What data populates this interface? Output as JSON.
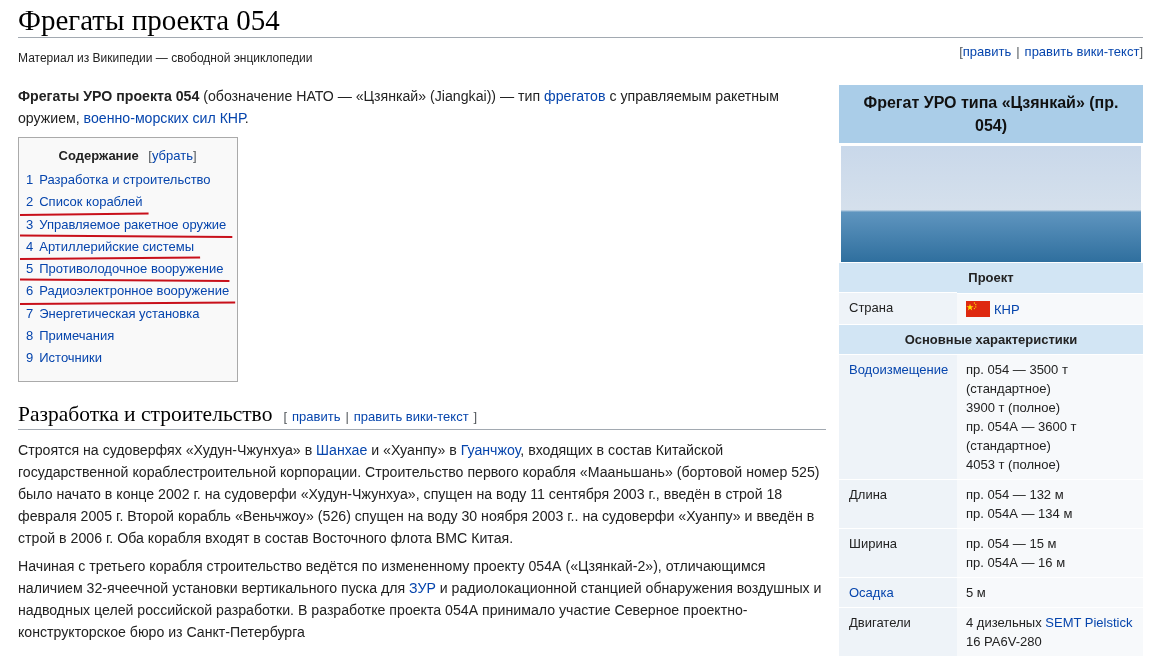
{
  "page": {
    "title": "Фрегаты проекта 054",
    "tagline": "Материал из Википедии — свободной энциклопедии",
    "edit_links": {
      "brackets": [
        "[",
        "]"
      ],
      "separator": "|",
      "links": [
        "править",
        "править вики-текст"
      ]
    }
  },
  "intro": [
    {
      "text": "Фрегаты УРО проекта 054",
      "kind": "bold"
    },
    {
      "text": " (обозначение НАТО — «Цзянкай» (Jiangkai)) — тип ",
      "kind": "text"
    },
    {
      "text": "фрегатов",
      "kind": "link"
    },
    {
      "text": " с управляемым ракетным оружием, ",
      "kind": "text"
    },
    {
      "text": "военно-морских сил КНР",
      "kind": "link"
    },
    {
      "text": ".",
      "kind": "text"
    }
  ],
  "toc": {
    "title": "Содержание",
    "toggle": {
      "brackets": [
        "[",
        "]"
      ],
      "label": "убрать"
    },
    "items": [
      {
        "number": "1",
        "label": "Разработка и строительство",
        "marked": false
      },
      {
        "number": "2",
        "label": "Список кораблей",
        "marked": true
      },
      {
        "number": "3",
        "label": "Управляемое ракетное оружие",
        "marked": true
      },
      {
        "number": "4",
        "label": "Артиллерийские системы",
        "marked": true
      },
      {
        "number": "5",
        "label": "Противолодочное вооружение",
        "marked": true
      },
      {
        "number": "6",
        "label": "Радиоэлектронное вооружение",
        "marked": true
      },
      {
        "number": "7",
        "label": "Энергетическая установка",
        "marked": false
      },
      {
        "number": "8",
        "label": "Примечания",
        "marked": false
      },
      {
        "number": "9",
        "label": "Источники",
        "marked": false
      }
    ]
  },
  "sections": [
    {
      "heading": "Разработка и строительство",
      "edit_links": {
        "brackets": [
          "[",
          "]"
        ],
        "separator": "|",
        "links": [
          "править",
          "править вики-текст"
        ]
      },
      "paragraphs": [
        [
          {
            "text": "Строятся на судоверфях «Худун-Чжунхуа» в ",
            "kind": "text"
          },
          {
            "text": "Шанхае",
            "kind": "link"
          },
          {
            "text": " и «Хуанпу» в ",
            "kind": "text"
          },
          {
            "text": "Гуанчжоу",
            "kind": "link"
          },
          {
            "text": ", входящих в состав Китайской государственной кораблестроительной корпорации. Строительство первого корабля «Мааньшань» (бортовой номер 525) было начато в конце 2002 г. на судоверфи «Худун-Чжунхуа», спущен на воду 11 сентября 2003 г., введён в строй 18 февраля 2005 г. Второй корабль «Веньчжоу» (526) спущен на воду 30 ноября 2003 г.. на судоверфи «Хуанпу» и введён в строй в 2006 г. Оба корабля входят в состав Восточного флота ВМС Китая.",
            "kind": "text"
          }
        ],
        [
          {
            "text": "Начиная с третьего корабля строительство ведётся по измененному проекту 054А («Цзянкай-2»), отличающимся наличием 32-ячеечной установки вертикального пуска для ",
            "kind": "text"
          },
          {
            "text": "ЗУР",
            "kind": "link"
          },
          {
            "text": " и радиолокационной станцией обнаружения воздушных и надводных целей российской разработки. В разработке проекта 054А принимало участие Северное проектно-конструкторское бюро из Санкт-Петербурга",
            "kind": "text"
          }
        ]
      ]
    }
  ],
  "infobox": {
    "title": "Фрегат УРО типа «Цзянкай» (пр. 054)",
    "rows": [
      {
        "kind": "section",
        "label": "Проект"
      },
      {
        "kind": "country",
        "label": "Страна",
        "label_link": false,
        "value": "КНР"
      },
      {
        "kind": "section",
        "label": "Основные характеристики"
      },
      {
        "kind": "data",
        "label": "Водоизмещение",
        "label_link": true,
        "lines": [
          [
            {
              "text": "пр. 054 — 3500 т (стандартное)",
              "kind": "text"
            }
          ],
          [
            {
              "text": "3900 т (полное)",
              "kind": "text"
            }
          ],
          [
            {
              "text": "пр. 054А — 3600 т (стандартное)",
              "kind": "text"
            }
          ],
          [
            {
              "text": "4053 т (полное)",
              "kind": "text"
            }
          ]
        ]
      },
      {
        "kind": "data",
        "label": "Длина",
        "label_link": false,
        "lines": [
          [
            {
              "text": "пр. 054 — 132 м",
              "kind": "text"
            }
          ],
          [
            {
              "text": "пр. 054А — 134 м",
              "kind": "text"
            }
          ]
        ]
      },
      {
        "kind": "data",
        "label": "Ширина",
        "label_link": false,
        "lines": [
          [
            {
              "text": "пр. 054 — 15 м",
              "kind": "text"
            }
          ],
          [
            {
              "text": "пр. 054А — 16 м",
              "kind": "text"
            }
          ]
        ]
      },
      {
        "kind": "data",
        "label": "Осадка",
        "label_link": true,
        "lines": [
          [
            {
              "text": "5 м",
              "kind": "text"
            }
          ]
        ]
      },
      {
        "kind": "data",
        "label": "Двигатели",
        "label_link": false,
        "lines": [
          [
            {
              "text": "4 дизельных ",
              "kind": "text"
            },
            {
              "text": "SEMT Pielstick",
              "kind": "link"
            },
            {
              "text": " 16 PA6V-280",
              "kind": "text"
            }
          ]
        ]
      }
    ]
  }
}
